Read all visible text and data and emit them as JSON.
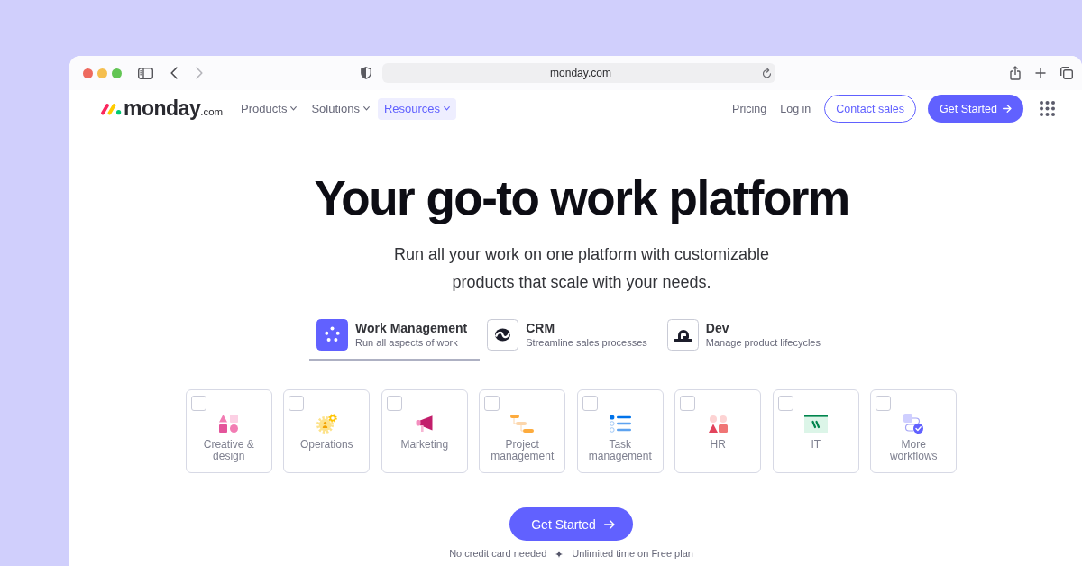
{
  "browser": {
    "url": "monday.com"
  },
  "nav": {
    "logo": {
      "wordmark": "monday",
      "suffix": ".com"
    },
    "menus": [
      {
        "label": "Products",
        "selected": false
      },
      {
        "label": "Solutions",
        "selected": false
      },
      {
        "label": "Resources",
        "selected": true
      }
    ],
    "links": [
      "Pricing",
      "Log in"
    ],
    "buttons": [
      {
        "kind": "outline",
        "label": "Contact sales"
      },
      {
        "kind": "primary",
        "label": "Get Started"
      }
    ]
  },
  "hero": {
    "title": "Your go-to work platform",
    "subtitle": "Run all your work on one platform with customizable products that scale with your needs."
  },
  "product_tabs": [
    {
      "title": "Work Management",
      "subtitle": "Run all aspects of work",
      "selected": true
    },
    {
      "title": "CRM",
      "subtitle": "Streamline sales processes",
      "selected": false
    },
    {
      "title": "Dev",
      "subtitle": "Manage product lifecycles",
      "selected": false
    }
  ],
  "workflows": [
    {
      "label": "Creative & design",
      "checked": false
    },
    {
      "label": "Operations",
      "checked": false
    },
    {
      "label": "Marketing",
      "checked": false
    },
    {
      "label": "Project management",
      "checked": false
    },
    {
      "label": "Task management",
      "checked": false
    },
    {
      "label": "HR",
      "checked": false
    },
    {
      "label": "IT",
      "checked": false
    },
    {
      "label": "More workflows",
      "checked": false
    }
  ],
  "cta": {
    "label": "Get Started"
  },
  "notes": [
    "No credit card needed",
    "Unlimited time on Free plan"
  ]
}
